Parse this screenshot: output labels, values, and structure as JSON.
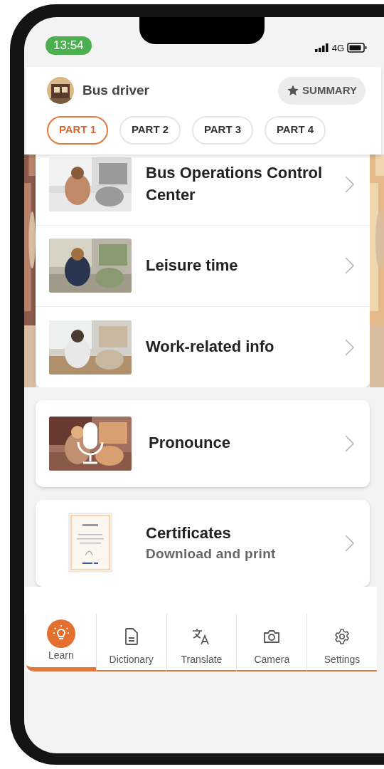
{
  "status_bar": {
    "time": "13:54",
    "network": "4G"
  },
  "header": {
    "title": "Bus driver",
    "summary_button": "SUMMARY"
  },
  "tabs": [
    {
      "label": "PART 1",
      "selected": true
    },
    {
      "label": "PART 2",
      "selected": false
    },
    {
      "label": "PART 3",
      "selected": false
    },
    {
      "label": "PART 4",
      "selected": false
    }
  ],
  "topics": [
    {
      "title": "Bus Operations Control Center"
    },
    {
      "title": "Leisure time"
    },
    {
      "title": "Work-related info"
    }
  ],
  "features": [
    {
      "kind": "pronounce",
      "title": "Pronounce"
    },
    {
      "kind": "certificates",
      "title": "Certificates",
      "subtitle": "Download and print"
    }
  ],
  "bottom_nav": [
    {
      "kind": "learn",
      "label": "Learn",
      "selected": true
    },
    {
      "kind": "dictionary",
      "label": "Dictionary",
      "selected": false
    },
    {
      "kind": "translate",
      "label": "Translate",
      "selected": false
    },
    {
      "kind": "camera",
      "label": "Camera",
      "selected": false
    },
    {
      "kind": "settings",
      "label": "Settings",
      "selected": false
    }
  ]
}
